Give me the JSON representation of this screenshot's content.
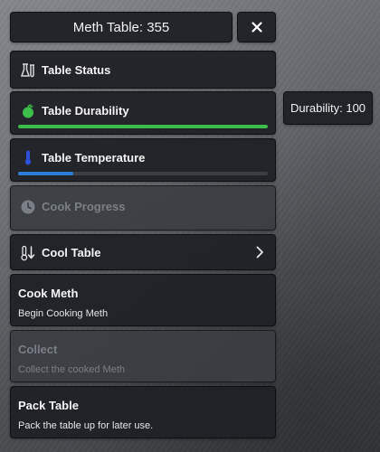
{
  "header": {
    "title": "Meth Table: 355",
    "close_glyph": "✕"
  },
  "status_rows": [
    {
      "label": "Table Status",
      "icon": "flask-icon"
    },
    {
      "label": "Table Durability",
      "icon": "apple-icon",
      "progress": 1.0,
      "bar_color": "#3cbf4a"
    },
    {
      "label": "Table Temperature",
      "icon": "thermometer-icon",
      "progress": 0.22,
      "bar_color": "#2c7fd8"
    },
    {
      "label": "Cook Progress",
      "icon": "clock-icon",
      "disabled": true
    }
  ],
  "cool_table": {
    "label": "Cool Table",
    "icon": "thermometer-down-icon"
  },
  "tooltip": {
    "text": "Durability: 100"
  },
  "menu_items": [
    {
      "title": "Cook Meth",
      "description": "Begin Cooking Meth",
      "disabled": false
    },
    {
      "title": "Collect",
      "description": "Collect the cooked Meth",
      "disabled": true
    },
    {
      "title": "Pack Table",
      "description": "Pack the table up for later use.",
      "disabled": false
    }
  ],
  "colors": {
    "accent_green": "#3cbf4a",
    "accent_blue": "#2c7fd8",
    "panel": "#1f2126",
    "panel_disabled": "#3a3d43"
  }
}
